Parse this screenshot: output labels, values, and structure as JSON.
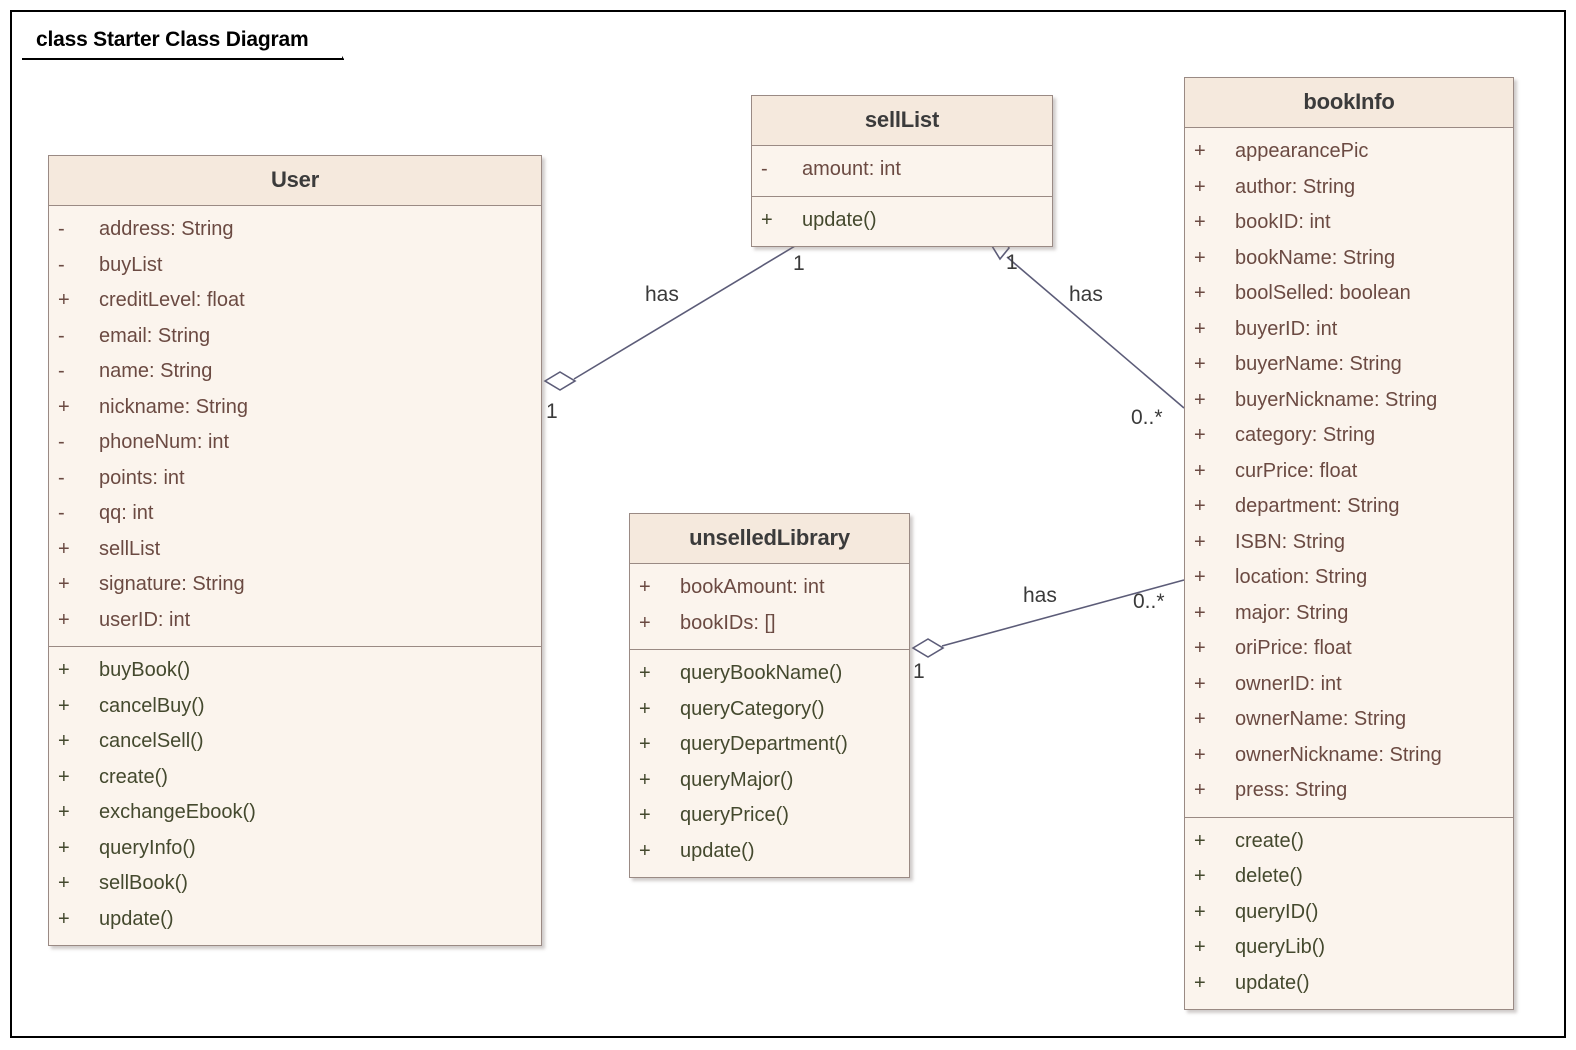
{
  "frame": {
    "title": "class Starter Class Diagram"
  },
  "classes": [
    {
      "name": "User",
      "attributes": [
        {
          "vis": "-",
          "member": "address: String"
        },
        {
          "vis": "-",
          "member": "buyList"
        },
        {
          "vis": "+",
          "member": "creditLevel: float"
        },
        {
          "vis": "-",
          "member": "email: String"
        },
        {
          "vis": "-",
          "member": "name: String"
        },
        {
          "vis": "+",
          "member": "nickname: String"
        },
        {
          "vis": "-",
          "member": "phoneNum: int"
        },
        {
          "vis": "-",
          "member": "points: int"
        },
        {
          "vis": "-",
          "member": "qq: int"
        },
        {
          "vis": "+",
          "member": "sellList"
        },
        {
          "vis": "+",
          "member": "signature: String"
        },
        {
          "vis": "+",
          "member": "userID: int"
        }
      ],
      "operations": [
        {
          "vis": "+",
          "member": "buyBook()"
        },
        {
          "vis": "+",
          "member": "cancelBuy()"
        },
        {
          "vis": "+",
          "member": "cancelSell()"
        },
        {
          "vis": "+",
          "member": "create()"
        },
        {
          "vis": "+",
          "member": "exchangeEbook()"
        },
        {
          "vis": "+",
          "member": "queryInfo()"
        },
        {
          "vis": "+",
          "member": "sellBook()"
        },
        {
          "vis": "+",
          "member": "update()"
        }
      ]
    },
    {
      "name": "sellList",
      "attributes": [
        {
          "vis": "-",
          "member": "amount: int"
        }
      ],
      "operations": [
        {
          "vis": "+",
          "member": "update()"
        }
      ]
    },
    {
      "name": "unselledLibrary",
      "attributes": [
        {
          "vis": "+",
          "member": "bookAmount: int"
        },
        {
          "vis": "+",
          "member": "bookIDs: []"
        }
      ],
      "operations": [
        {
          "vis": "+",
          "member": "queryBookName()"
        },
        {
          "vis": "+",
          "member": "queryCategory()"
        },
        {
          "vis": "+",
          "member": "queryDepartment()"
        },
        {
          "vis": "+",
          "member": "queryMajor()"
        },
        {
          "vis": "+",
          "member": "queryPrice()"
        },
        {
          "vis": "+",
          "member": "update()"
        }
      ]
    },
    {
      "name": "bookInfo",
      "attributes": [
        {
          "vis": "+",
          "member": "appearancePic"
        },
        {
          "vis": "+",
          "member": "author: String"
        },
        {
          "vis": "+",
          "member": "bookID: int"
        },
        {
          "vis": "+",
          "member": "bookName: String"
        },
        {
          "vis": "+",
          "member": "boolSelled: boolean"
        },
        {
          "vis": "+",
          "member": "buyerID: int"
        },
        {
          "vis": "+",
          "member": "buyerName: String"
        },
        {
          "vis": "+",
          "member": "buyerNickname: String"
        },
        {
          "vis": "+",
          "member": "category: String"
        },
        {
          "vis": "+",
          "member": "curPrice: float"
        },
        {
          "vis": "+",
          "member": "department: String"
        },
        {
          "vis": "+",
          "member": "ISBN: String"
        },
        {
          "vis": "+",
          "member": "location: String"
        },
        {
          "vis": "+",
          "member": "major: String"
        },
        {
          "vis": "+",
          "member": "oriPrice: float"
        },
        {
          "vis": "+",
          "member": "ownerID: int"
        },
        {
          "vis": "+",
          "member": "ownerName: String"
        },
        {
          "vis": "+",
          "member": "ownerNickname: String"
        },
        {
          "vis": "+",
          "member": "press: String"
        }
      ],
      "operations": [
        {
          "vis": "+",
          "member": "create()"
        },
        {
          "vis": "+",
          "member": "delete()"
        },
        {
          "vis": "+",
          "member": "queryID()"
        },
        {
          "vis": "+",
          "member": "queryLib()"
        },
        {
          "vis": "+",
          "member": "update()"
        }
      ]
    }
  ],
  "associations": [
    {
      "id": "user-selllist",
      "label": "has",
      "source_multiplicity": "1",
      "target_multiplicity": "1"
    },
    {
      "id": "selllist-bookinfo",
      "label": "has",
      "source_multiplicity": "1",
      "target_multiplicity": "0..*"
    },
    {
      "id": "unselledlibrary-bookinfo",
      "label": "has",
      "source_multiplicity": "1",
      "target_multiplicity": "0..*"
    }
  ],
  "colors": {
    "header_fill": "#f5e9dd",
    "body_fill": "#fbf4ed",
    "border": "#9a8a84",
    "attribute_text": "#6b4a42",
    "operation_text": "#44492e",
    "connector": "#5c5c78"
  }
}
